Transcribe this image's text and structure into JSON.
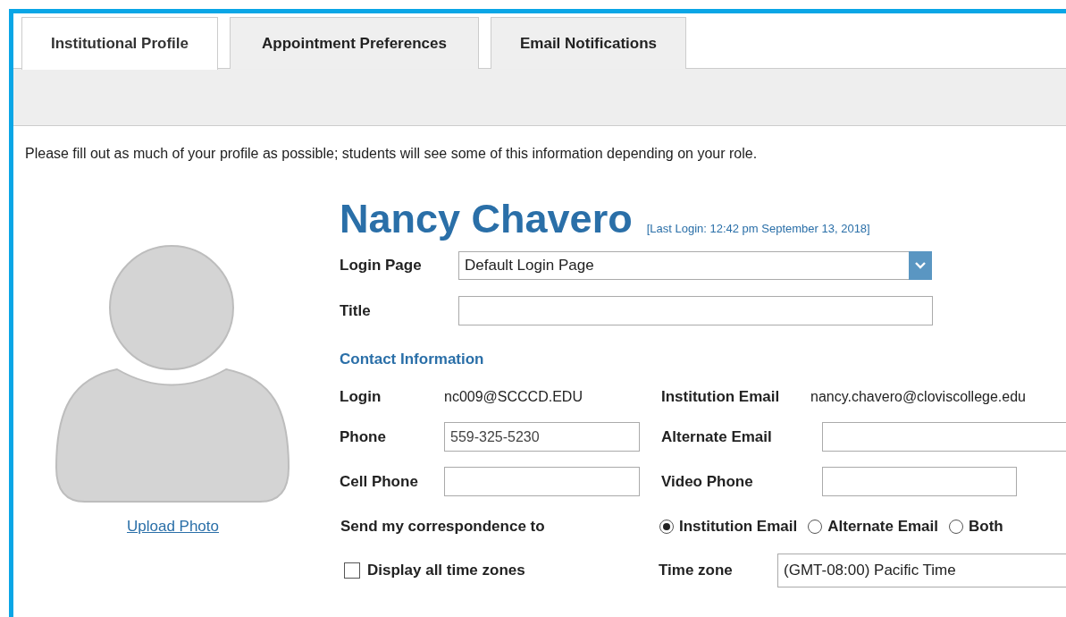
{
  "tabs": [
    {
      "label": "Institutional Profile",
      "selected": true
    },
    {
      "label": "Appointment Preferences",
      "selected": false
    },
    {
      "label": "Email Notifications",
      "selected": false
    }
  ],
  "intro": "Please fill out as much of your profile as possible; students will see some of this information depending on your role.",
  "photo": {
    "link": "Upload Photo"
  },
  "profile": {
    "name": "Nancy Chavero",
    "last_login": "[Last Login: 12:42 pm September 13, 2018]"
  },
  "login_page": {
    "label": "Login Page",
    "value": "Default Login Page"
  },
  "title_field": {
    "label": "Title"
  },
  "contact": {
    "heading": "Contact Information",
    "login": {
      "label": "Login",
      "value": "nc009@SCCCD.EDU"
    },
    "institution_email": {
      "label": "Institution Email",
      "value": "nancy.chavero@cloviscollege.edu"
    },
    "phone": {
      "label": "Phone",
      "value": "559-325-5230"
    },
    "alternate_email": {
      "label": "Alternate Email"
    },
    "cell_phone": {
      "label": "Cell Phone"
    },
    "video_phone": {
      "label": "Video Phone"
    }
  },
  "correspondence": {
    "label": "Send my correspondence to",
    "options": [
      {
        "label": "Institution Email",
        "selected": true
      },
      {
        "label": "Alternate Email",
        "selected": false
      },
      {
        "label": "Both",
        "selected": false
      }
    ]
  },
  "all_time_zones": {
    "label": "Display all time zones",
    "checked": false
  },
  "time_zone": {
    "label": "Time zone",
    "value": "(GMT-08:00) Pacific Time"
  }
}
